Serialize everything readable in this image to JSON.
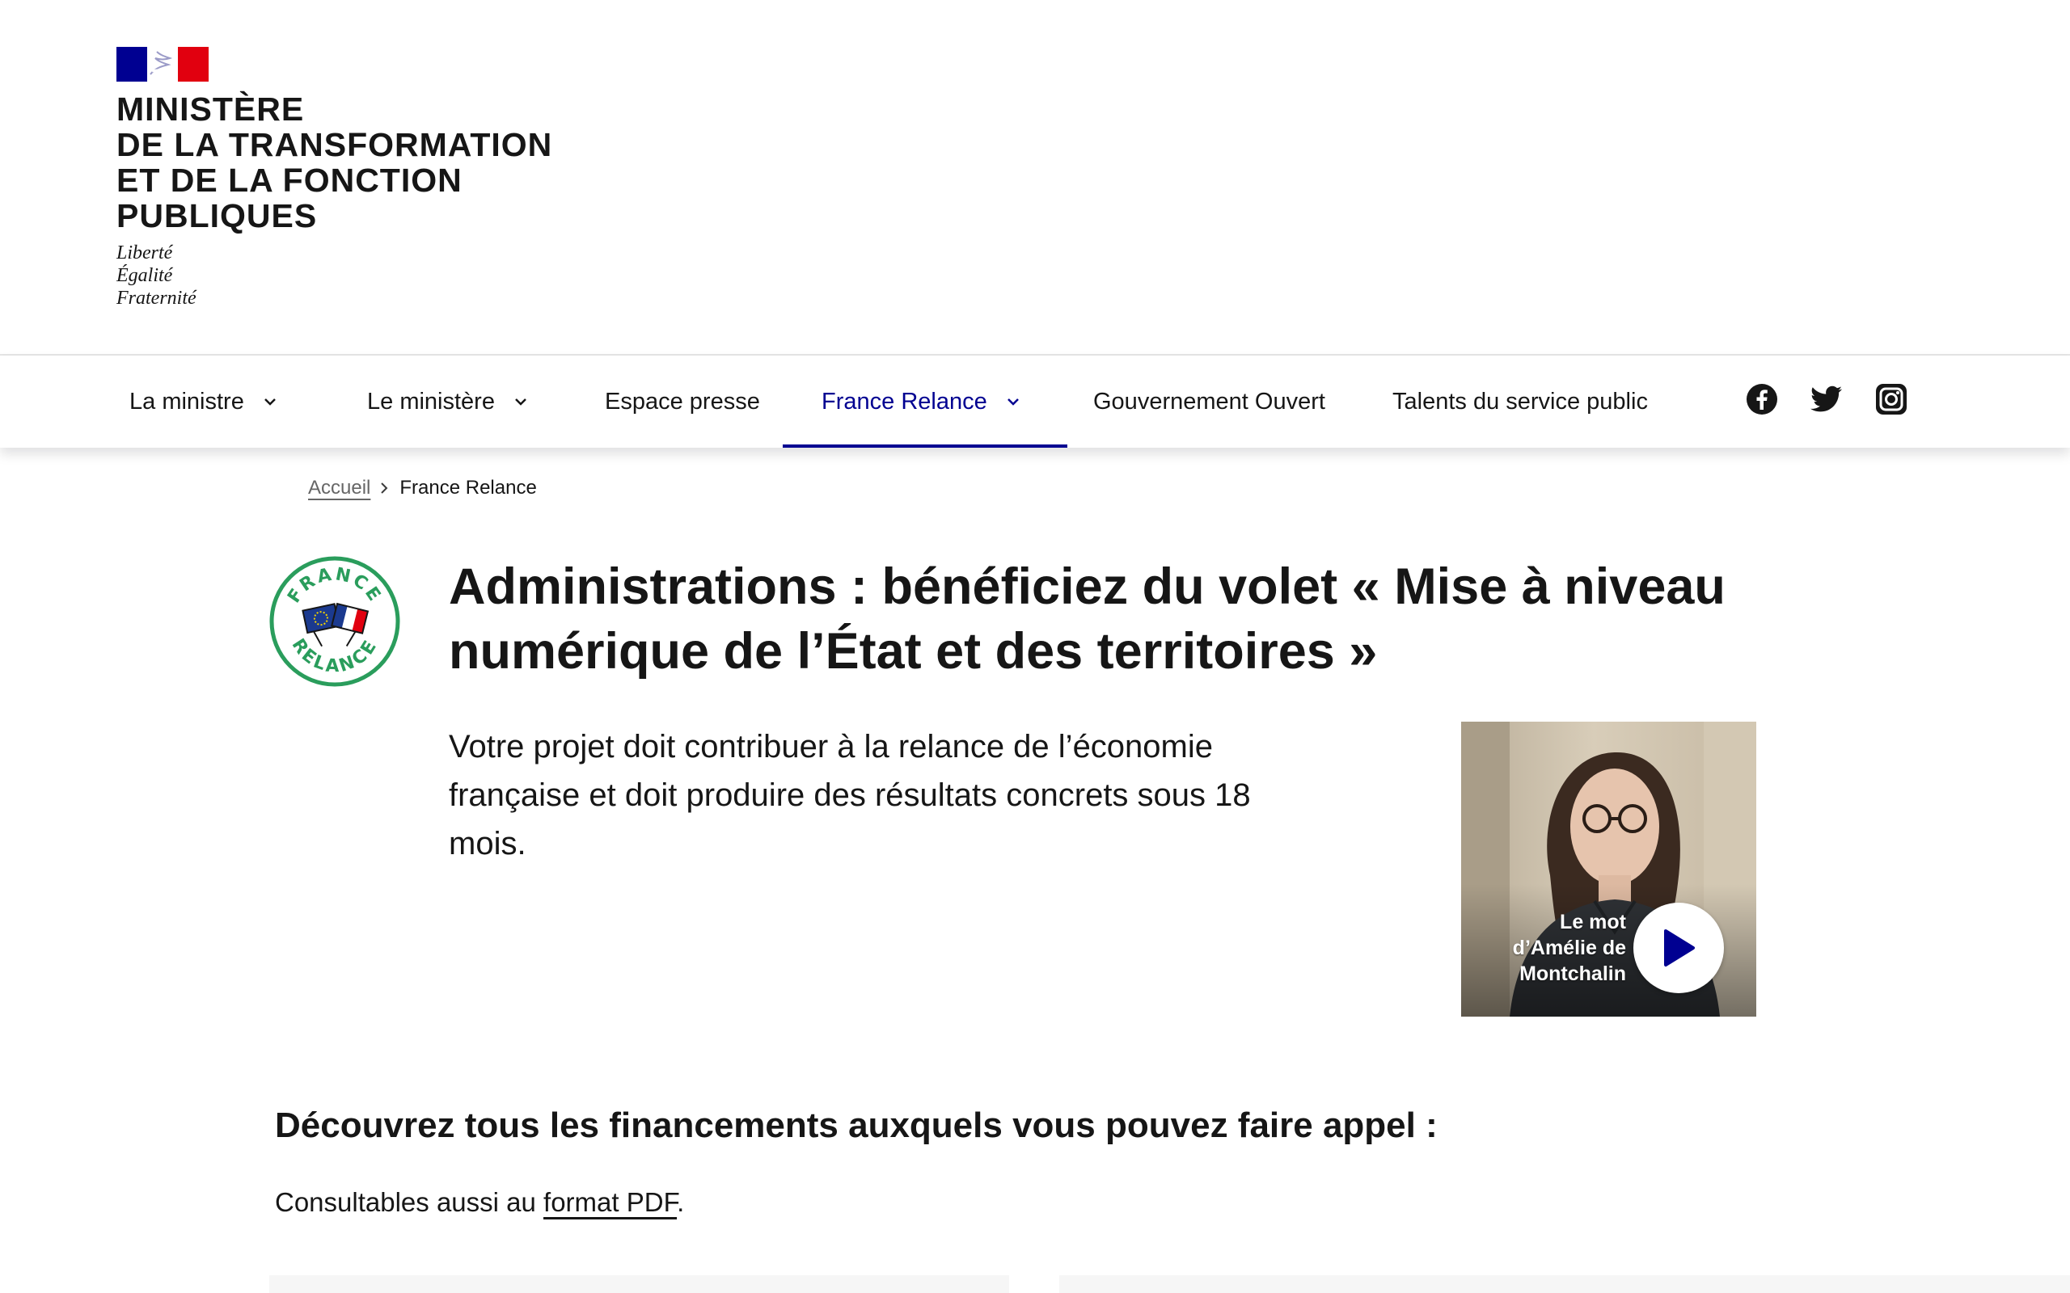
{
  "header": {
    "ministry_lines": [
      "MINISTÈRE",
      "DE LA TRANSFORMATION",
      "ET DE LA FONCTION",
      "PUBLIQUES"
    ],
    "motto": [
      "Liberté",
      "Égalité",
      "Fraternité"
    ],
    "flag_colors": {
      "blue": "#000091",
      "white": "#ffffff",
      "red": "#e1000f"
    }
  },
  "nav": {
    "items": [
      {
        "label": "La ministre",
        "has_dropdown": true,
        "active": false
      },
      {
        "label": "Le ministère",
        "has_dropdown": true,
        "active": false
      },
      {
        "label": "Espace presse",
        "has_dropdown": false,
        "active": false
      },
      {
        "label": "France Relance",
        "has_dropdown": true,
        "active": true
      },
      {
        "label": "Gouvernement Ouvert",
        "has_dropdown": false,
        "active": false
      },
      {
        "label": "Talents du service public",
        "has_dropdown": false,
        "active": false
      }
    ],
    "social_icons": [
      "facebook-icon",
      "twitter-icon",
      "instagram-icon"
    ],
    "accent_color": "#000091"
  },
  "breadcrumb": {
    "home": "Accueil",
    "current": "France Relance"
  },
  "badge": {
    "top_text": "FRANCE",
    "bottom_text": "RELANCE",
    "color": "#2a9d5c"
  },
  "hero": {
    "title_lines": [
      "Administrations : bénéficiez du volet « Mise à niveau",
      "numérique de l’État et des territoires »"
    ],
    "lead_lines": [
      "Votre projet doit contribuer à la relance de l’économie",
      "française et doit produire des résultats concrets sous 18",
      "mois."
    ]
  },
  "video": {
    "caption_lines": [
      "Le mot",
      "d’Amélie de",
      "Montchalin"
    ],
    "play_icon": "play-icon"
  },
  "financing": {
    "title": "Découvrez tous les financements auxquels vous pouvez faire appel :",
    "consult_prefix": "Consultables aussi au ",
    "consult_link": "format PDF",
    "consult_suffix": "."
  }
}
